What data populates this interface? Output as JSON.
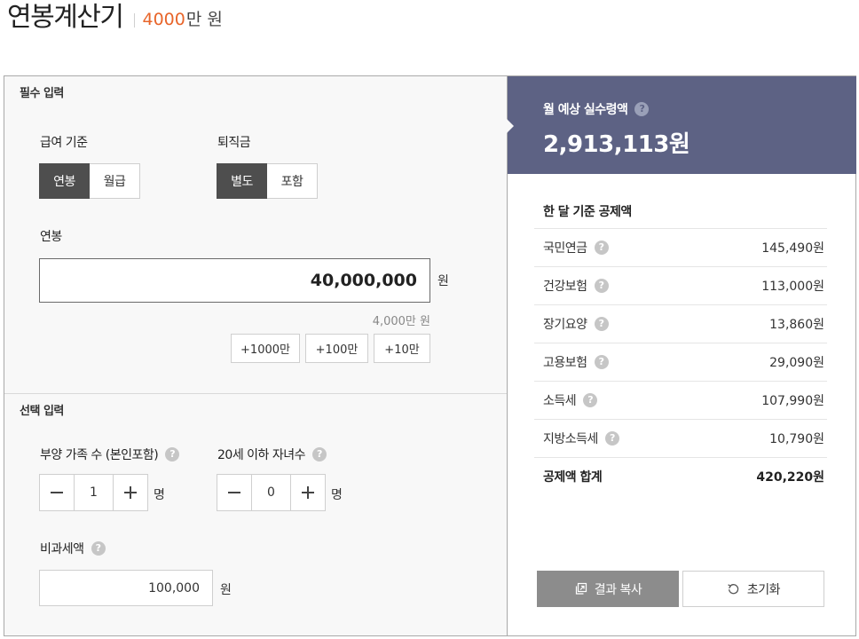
{
  "header": {
    "title": "연봉계산기",
    "amount": "4000",
    "amount_unit": "만 원"
  },
  "required": {
    "section_label": "필수 입력",
    "pay_basis": {
      "label": "급여 기준",
      "options": [
        "연봉",
        "월급"
      ],
      "selected": "연봉"
    },
    "severance": {
      "label": "퇴직금",
      "options": [
        "별도",
        "포함"
      ],
      "selected": "별도"
    },
    "salary": {
      "label": "연봉",
      "value": "40,000,000",
      "unit": "원",
      "sub_text": "4,000만 원"
    },
    "quick_add": [
      "+1000만",
      "+100만",
      "+10만"
    ]
  },
  "optional": {
    "section_label": "선택 입력",
    "dependents": {
      "label": "부양 가족 수 (본인포함)",
      "value": "1",
      "unit": "명"
    },
    "children": {
      "label": "20세 이하 자녀수",
      "value": "0",
      "unit": "명"
    },
    "nontax": {
      "label": "비과세액",
      "value": "100,000",
      "unit": "원"
    }
  },
  "result": {
    "label": "월 예상 실수령액",
    "value": "2,913,113원",
    "deductions_title": "한 달 기준 공제액",
    "deductions": [
      {
        "name": "국민연금",
        "amount": "145,490원"
      },
      {
        "name": "건강보험",
        "amount": "113,000원"
      },
      {
        "name": "장기요양",
        "amount": "13,860원"
      },
      {
        "name": "고용보험",
        "amount": "29,090원"
      },
      {
        "name": "소득세",
        "amount": "107,990원"
      },
      {
        "name": "지방소득세",
        "amount": "10,790원"
      }
    ],
    "total": {
      "name": "공제액 합계",
      "amount": "420,220원"
    },
    "copy_label": "결과 복사",
    "reset_label": "초기화"
  },
  "icons": {
    "help": "help-icon",
    "minus": "minus-icon",
    "plus": "plus-icon",
    "copy": "copy-icon",
    "reset": "reset-icon"
  },
  "colors": {
    "accent": "#e8652a",
    "result_bg": "#5d6284",
    "active_toggle": "#4e4e4e",
    "copy_button": "#8c8c8c"
  }
}
